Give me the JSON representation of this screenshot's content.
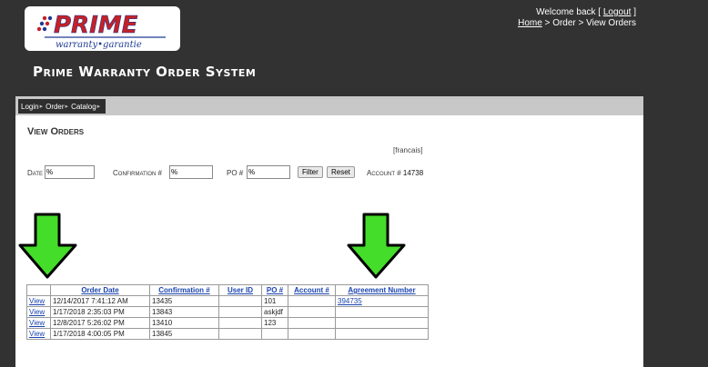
{
  "header": {
    "logo": {
      "brand": "PRIME",
      "tagline": "warranty•garantie"
    },
    "welcome_prefix": "Welcome back [ ",
    "logout": "Logout",
    "welcome_suffix": " ]",
    "breadcrumb": {
      "home": "Home",
      "sep1": " > ",
      "order": "Order",
      "sep2": " > ",
      "current": "View Orders"
    },
    "app_title": "Prime Warranty Order System"
  },
  "nav": {
    "items": [
      "Login",
      "Order",
      "Catalog"
    ]
  },
  "page": {
    "heading": "View Orders",
    "lang_link": "[francais]"
  },
  "filters": {
    "date_label": "Date",
    "date_value": "%",
    "confirmation_label": "Confirmation #",
    "confirmation_value": "%",
    "po_label": "PO #",
    "po_value": "%",
    "filter_button": "Filter",
    "reset_button": "Reset",
    "account_label": "Account # ",
    "account_value": "14738"
  },
  "table": {
    "headers": [
      "",
      "Order Date",
      "Confirmation #",
      "User ID",
      "PO #",
      "Account #",
      "Agreement Number"
    ],
    "rows": [
      {
        "action": "View",
        "order_date": "12/14/2017 7:41:12 AM",
        "confirmation": "13435",
        "user_id": "",
        "po": "101",
        "account": "",
        "agreement": "394735"
      },
      {
        "action": "View",
        "order_date": "1/17/2018 2:35:03 PM",
        "confirmation": "13843",
        "user_id": "",
        "po": "askjdf",
        "account": "",
        "agreement": ""
      },
      {
        "action": "View",
        "order_date": "12/8/2017 5:26:02 PM",
        "confirmation": "13410",
        "user_id": "",
        "po": "123",
        "account": "",
        "agreement": ""
      },
      {
        "action": "View",
        "order_date": "1/17/2018 4:00:05 PM",
        "confirmation": "13845",
        "user_id": "",
        "po": "",
        "account": "",
        "agreement": ""
      }
    ]
  },
  "colors": {
    "arrow_fill": "#44dd2a",
    "arrow_stroke": "#000000",
    "link": "#1a44b0",
    "logo_red": "#c62026",
    "logo_blue": "#1f3a93"
  }
}
